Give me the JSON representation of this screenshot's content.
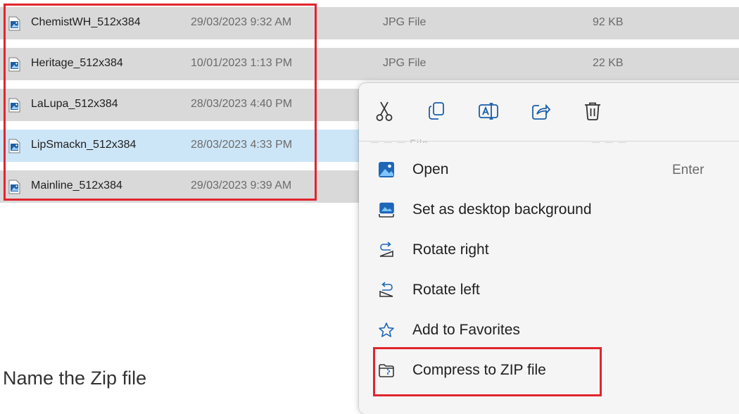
{
  "files": [
    {
      "name": "ChemistWH_512x384",
      "date": "29/03/2023 9:32 AM",
      "type": "JPG File",
      "size": "92 KB",
      "selected": false
    },
    {
      "name": "Heritage_512x384",
      "date": "10/01/2023 1:13 PM",
      "type": "JPG File",
      "size": "22 KB",
      "selected": false
    },
    {
      "name": "LaLupa_512x384",
      "date": "28/03/2023 4:40 PM",
      "type": "",
      "size": "",
      "selected": false
    },
    {
      "name": "LipSmackn_512x384",
      "date": "28/03/2023 4:33 PM",
      "type": "",
      "size": "",
      "selected": true
    },
    {
      "name": "Mainline_512x384",
      "date": "29/03/2023 9:39 AM",
      "type": "",
      "size": "",
      "selected": false
    }
  ],
  "file_icon": "jpg-image-file-icon",
  "context_menu": {
    "quick_actions": [
      {
        "name": "cut",
        "icon": "scissors-icon"
      },
      {
        "name": "copy",
        "icon": "copy-icon"
      },
      {
        "name": "rename",
        "icon": "rename-icon"
      },
      {
        "name": "share",
        "icon": "share-icon"
      },
      {
        "name": "delete",
        "icon": "trash-icon"
      }
    ],
    "items": [
      {
        "label": "Open",
        "shortcut": "Enter",
        "icon": "photos-app-icon"
      },
      {
        "label": "Set as desktop background",
        "shortcut": "",
        "icon": "desktop-background-icon"
      },
      {
        "label": "Rotate right",
        "shortcut": "",
        "icon": "rotate-right-icon"
      },
      {
        "label": "Rotate left",
        "shortcut": "",
        "icon": "rotate-left-icon"
      },
      {
        "label": "Add to Favorites",
        "shortcut": "",
        "icon": "star-icon"
      },
      {
        "label": "Compress to ZIP file",
        "shortcut": "",
        "icon": "zip-folder-icon"
      }
    ]
  },
  "caption": "Name the Zip file",
  "colors": {
    "highlight_red": "#e0252e",
    "row_gray": "#d9d9d9",
    "row_selected": "#cde6f7",
    "menu_bg": "#f5f5f5",
    "icon_blue": "#1a5fa8"
  }
}
